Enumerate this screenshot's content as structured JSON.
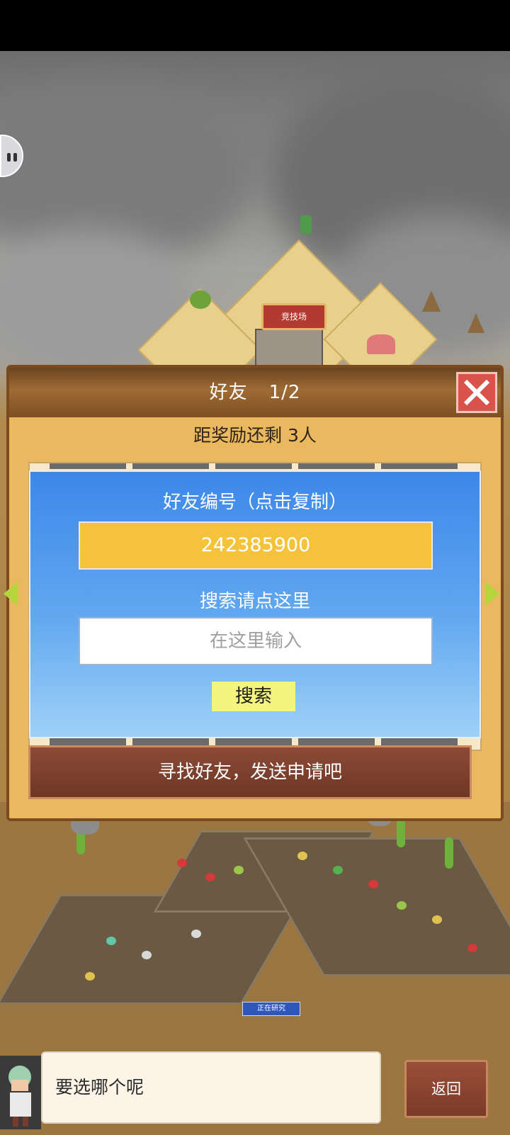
{
  "game_scene": {
    "arena_sign": "竞技场",
    "research_status": "正在研究"
  },
  "friend_panel": {
    "title": "好友",
    "page_indicator": "1/2",
    "reward_text": "距奖励还剩 3人",
    "find_friends_label": "寻找好友，发送申请吧"
  },
  "friend_code_modal": {
    "title": "好友编号（点击复制）",
    "friend_id": "242385900",
    "search_label": "搜索请点这里",
    "search_placeholder": "在这里输入",
    "search_button": "搜索"
  },
  "dialog": {
    "text": "要选哪个呢",
    "back_button": "返回"
  },
  "colors": {
    "panel_bg": "#e9b85f",
    "modal_blue": "#3d87e9",
    "friend_id_bg": "#f5c33b",
    "search_button_bg": "#f3f57f",
    "close_red": "#d9534a",
    "arrow_green": "#b6d53d"
  }
}
